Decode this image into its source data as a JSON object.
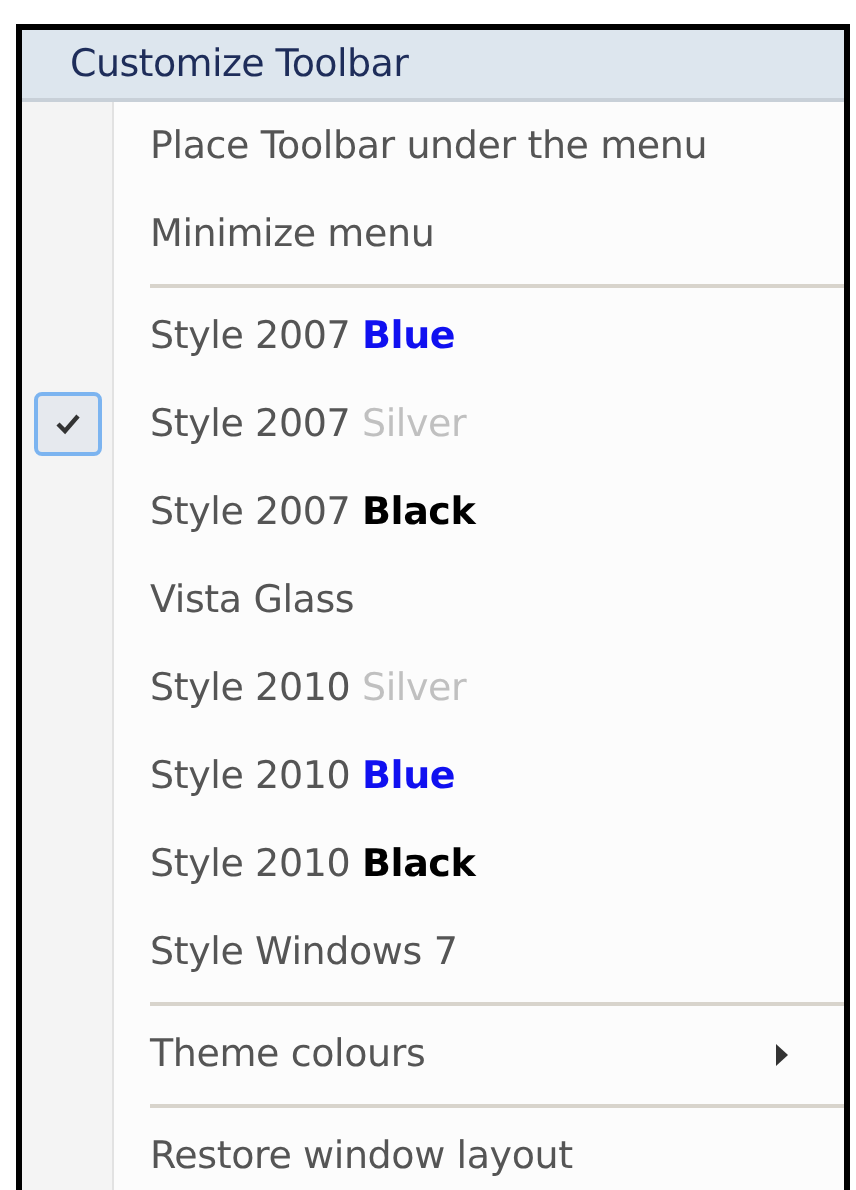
{
  "menu": {
    "title": "Customize Toolbar",
    "items": [
      {
        "kind": "item",
        "label": "Place Toolbar under the menu",
        "checked": false
      },
      {
        "kind": "item",
        "label": "Minimize menu",
        "checked": false
      },
      {
        "kind": "separator"
      },
      {
        "kind": "item",
        "label": "Style 2007",
        "variant": {
          "text": "Blue",
          "color": "#1010f0",
          "bold": true
        },
        "checked": false
      },
      {
        "kind": "item",
        "label": "Style 2007",
        "variant": {
          "text": "Silver",
          "color": "#c0c0c0",
          "bold": false
        },
        "checked": true
      },
      {
        "kind": "item",
        "label": "Style 2007",
        "variant": {
          "text": "Black",
          "color": "#000000",
          "bold": true
        },
        "checked": false
      },
      {
        "kind": "item",
        "label": "Vista Glass",
        "checked": false
      },
      {
        "kind": "item",
        "label": "Style 2010",
        "variant": {
          "text": "Silver",
          "color": "#c0c0c0",
          "bold": false
        },
        "checked": false
      },
      {
        "kind": "item",
        "label": "Style 2010",
        "variant": {
          "text": "Blue",
          "color": "#1010f0",
          "bold": true
        },
        "checked": false
      },
      {
        "kind": "item",
        "label": "Style 2010",
        "variant": {
          "text": "Black",
          "color": "#000000",
          "bold": true
        },
        "checked": false
      },
      {
        "kind": "item",
        "label": "Style Windows 7",
        "checked": false
      },
      {
        "kind": "separator"
      },
      {
        "kind": "submenu",
        "label": "Theme colours",
        "checked": false
      },
      {
        "kind": "separator"
      },
      {
        "kind": "item",
        "label": "Restore window layout",
        "checked": false
      }
    ]
  }
}
